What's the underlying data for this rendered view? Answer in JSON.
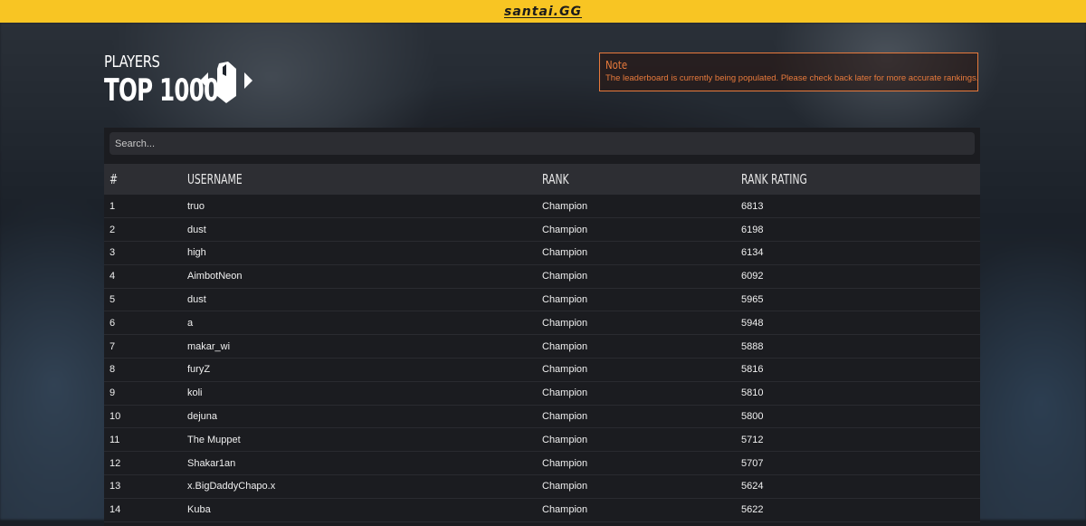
{
  "brand": {
    "logo_text": "santai.GG"
  },
  "header": {
    "subtitle": "PLAYERS",
    "title": "TOP 1000"
  },
  "note": {
    "title": "Note",
    "text": "The leaderboard is currently being populated. Please check back later for more accurate rankings."
  },
  "search": {
    "placeholder": "Search..."
  },
  "table": {
    "columns": [
      "#",
      "USERNAME",
      "RANK",
      "RANK RATING"
    ],
    "rows": [
      {
        "num": "1",
        "username": "truo",
        "rank": "Champion",
        "rating": "6813"
      },
      {
        "num": "2",
        "username": "dust",
        "rank": "Champion",
        "rating": "6198"
      },
      {
        "num": "3",
        "username": "high",
        "rank": "Champion",
        "rating": "6134"
      },
      {
        "num": "4",
        "username": "AimbotNeon",
        "rank": "Champion",
        "rating": "6092"
      },
      {
        "num": "5",
        "username": "dust",
        "rank": "Champion",
        "rating": "5965"
      },
      {
        "num": "6",
        "username": "a",
        "rank": "Champion",
        "rating": "5948"
      },
      {
        "num": "7",
        "username": "makar_wi",
        "rank": "Champion",
        "rating": "5888"
      },
      {
        "num": "8",
        "username": "furyZ",
        "rank": "Champion",
        "rating": "5816"
      },
      {
        "num": "9",
        "username": "koli",
        "rank": "Champion",
        "rating": "5810"
      },
      {
        "num": "10",
        "username": "dejuna",
        "rank": "Champion",
        "rating": "5800"
      },
      {
        "num": "11",
        "username": "The Muppet",
        "rank": "Champion",
        "rating": "5712"
      },
      {
        "num": "12",
        "username": "Shakar1an",
        "rank": "Champion",
        "rating": "5707"
      },
      {
        "num": "13",
        "username": "x.BigDaddyChapo.x",
        "rank": "Champion",
        "rating": "5624"
      },
      {
        "num": "14",
        "username": "Kuba",
        "rank": "Champion",
        "rating": "5622"
      }
    ]
  },
  "colors": {
    "accent": "#f8c523",
    "note": "#e87a3c",
    "panel": "#1b1c20"
  },
  "icons": {
    "emblem": "rank-emblem-icon"
  }
}
